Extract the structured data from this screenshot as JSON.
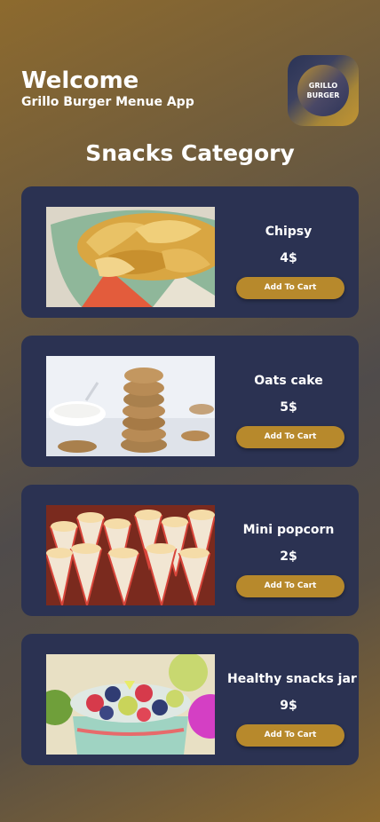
{
  "header": {
    "welcome": "Welcome",
    "subtitle": "Grillo Burger Menue App",
    "logo_line1": "GRILLO",
    "logo_line2": "BURGER"
  },
  "section_title": "Snacks Category",
  "items": [
    {
      "name": "Chipsy",
      "price": "4$",
      "button": "Add To Cart",
      "image": "chips-bowl-photo"
    },
    {
      "name": "Oats cake",
      "price": "5$",
      "button": "Add To Cart",
      "image": "oat-cookies-photo"
    },
    {
      "name": "Mini popcorn",
      "price": "2$",
      "button": "Add To Cart",
      "image": "popcorn-cones-photo"
    },
    {
      "name": "Healthy snacks jar",
      "price": "9$",
      "button": "Add To Cart",
      "image": "fruit-jar-photo"
    }
  ],
  "colors": {
    "card": "#2b3252",
    "button": "#b7892c",
    "accent_gold": "#8d6a2e"
  }
}
